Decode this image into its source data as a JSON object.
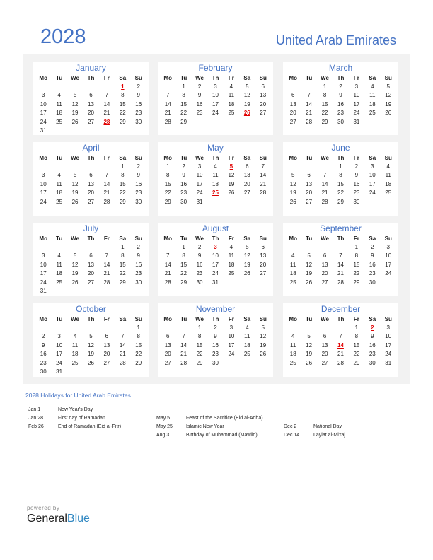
{
  "header": {
    "year": "2028",
    "country": "United Arab Emirates"
  },
  "dow": [
    "Mo",
    "Tu",
    "We",
    "Th",
    "Fr",
    "Sa",
    "Su"
  ],
  "colors": {
    "accent": "#4472c4",
    "holiday": "#e00000",
    "background_panel": "#f2f2f2"
  },
  "months": [
    {
      "name": "January",
      "weeks": [
        [
          "",
          "",
          "",
          "",
          "",
          "1",
          "2"
        ],
        [
          "3",
          "4",
          "5",
          "6",
          "7",
          "8",
          "9"
        ],
        [
          "10",
          "11",
          "12",
          "13",
          "14",
          "15",
          "16"
        ],
        [
          "17",
          "18",
          "19",
          "20",
          "21",
          "22",
          "23"
        ],
        [
          "24",
          "25",
          "26",
          "27",
          "28",
          "29",
          "30"
        ],
        [
          "31",
          "",
          "",
          "",
          "",
          "",
          ""
        ]
      ],
      "holidays": [
        "1",
        "28"
      ]
    },
    {
      "name": "February",
      "weeks": [
        [
          "",
          "1",
          "2",
          "3",
          "4",
          "5",
          "6"
        ],
        [
          "7",
          "8",
          "9",
          "10",
          "11",
          "12",
          "13"
        ],
        [
          "14",
          "15",
          "16",
          "17",
          "18",
          "19",
          "20"
        ],
        [
          "21",
          "22",
          "23",
          "24",
          "25",
          "26",
          "27"
        ],
        [
          "28",
          "29",
          "",
          "",
          "",
          "",
          ""
        ]
      ],
      "holidays": [
        "26"
      ]
    },
    {
      "name": "March",
      "weeks": [
        [
          "",
          "",
          "1",
          "2",
          "3",
          "4",
          "5"
        ],
        [
          "6",
          "7",
          "8",
          "9",
          "10",
          "11",
          "12"
        ],
        [
          "13",
          "14",
          "15",
          "16",
          "17",
          "18",
          "19"
        ],
        [
          "20",
          "21",
          "22",
          "23",
          "24",
          "25",
          "26"
        ],
        [
          "27",
          "28",
          "29",
          "30",
          "31",
          "",
          ""
        ]
      ],
      "holidays": []
    },
    {
      "name": "April",
      "weeks": [
        [
          "",
          "",
          "",
          "",
          "",
          "1",
          "2"
        ],
        [
          "3",
          "4",
          "5",
          "6",
          "7",
          "8",
          "9"
        ],
        [
          "10",
          "11",
          "12",
          "13",
          "14",
          "15",
          "16"
        ],
        [
          "17",
          "18",
          "19",
          "20",
          "21",
          "22",
          "23"
        ],
        [
          "24",
          "25",
          "26",
          "27",
          "28",
          "29",
          "30"
        ]
      ],
      "holidays": []
    },
    {
      "name": "May",
      "weeks": [
        [
          "1",
          "2",
          "3",
          "4",
          "5",
          "6",
          "7"
        ],
        [
          "8",
          "9",
          "10",
          "11",
          "12",
          "13",
          "14"
        ],
        [
          "15",
          "16",
          "17",
          "18",
          "19",
          "20",
          "21"
        ],
        [
          "22",
          "23",
          "24",
          "25",
          "26",
          "27",
          "28"
        ],
        [
          "29",
          "30",
          "31",
          "",
          "",
          "",
          ""
        ]
      ],
      "holidays": [
        "5",
        "25"
      ]
    },
    {
      "name": "June",
      "weeks": [
        [
          "",
          "",
          "",
          "1",
          "2",
          "3",
          "4"
        ],
        [
          "5",
          "6",
          "7",
          "8",
          "9",
          "10",
          "11"
        ],
        [
          "12",
          "13",
          "14",
          "15",
          "16",
          "17",
          "18"
        ],
        [
          "19",
          "20",
          "21",
          "22",
          "23",
          "24",
          "25"
        ],
        [
          "26",
          "27",
          "28",
          "29",
          "30",
          "",
          ""
        ]
      ],
      "holidays": []
    },
    {
      "name": "July",
      "weeks": [
        [
          "",
          "",
          "",
          "",
          "",
          "1",
          "2"
        ],
        [
          "3",
          "4",
          "5",
          "6",
          "7",
          "8",
          "9"
        ],
        [
          "10",
          "11",
          "12",
          "13",
          "14",
          "15",
          "16"
        ],
        [
          "17",
          "18",
          "19",
          "20",
          "21",
          "22",
          "23"
        ],
        [
          "24",
          "25",
          "26",
          "27",
          "28",
          "29",
          "30"
        ],
        [
          "31",
          "",
          "",
          "",
          "",
          "",
          ""
        ]
      ],
      "holidays": []
    },
    {
      "name": "August",
      "weeks": [
        [
          "",
          "1",
          "2",
          "3",
          "4",
          "5",
          "6"
        ],
        [
          "7",
          "8",
          "9",
          "10",
          "11",
          "12",
          "13"
        ],
        [
          "14",
          "15",
          "16",
          "17",
          "18",
          "19",
          "20"
        ],
        [
          "21",
          "22",
          "23",
          "24",
          "25",
          "26",
          "27"
        ],
        [
          "28",
          "29",
          "30",
          "31",
          "",
          "",
          ""
        ]
      ],
      "holidays": [
        "3"
      ]
    },
    {
      "name": "September",
      "weeks": [
        [
          "",
          "",
          "",
          "",
          "1",
          "2",
          "3"
        ],
        [
          "4",
          "5",
          "6",
          "7",
          "8",
          "9",
          "10"
        ],
        [
          "11",
          "12",
          "13",
          "14",
          "15",
          "16",
          "17"
        ],
        [
          "18",
          "19",
          "20",
          "21",
          "22",
          "23",
          "24"
        ],
        [
          "25",
          "26",
          "27",
          "28",
          "29",
          "30",
          ""
        ]
      ],
      "holidays": []
    },
    {
      "name": "October",
      "weeks": [
        [
          "",
          "",
          "",
          "",
          "",
          "",
          "1"
        ],
        [
          "2",
          "3",
          "4",
          "5",
          "6",
          "7",
          "8"
        ],
        [
          "9",
          "10",
          "11",
          "12",
          "13",
          "14",
          "15"
        ],
        [
          "16",
          "17",
          "18",
          "19",
          "20",
          "21",
          "22"
        ],
        [
          "23",
          "24",
          "25",
          "26",
          "27",
          "28",
          "29"
        ],
        [
          "30",
          "31",
          "",
          "",
          "",
          "",
          ""
        ]
      ],
      "holidays": []
    },
    {
      "name": "November",
      "weeks": [
        [
          "",
          "",
          "1",
          "2",
          "3",
          "4",
          "5"
        ],
        [
          "6",
          "7",
          "8",
          "9",
          "10",
          "11",
          "12"
        ],
        [
          "13",
          "14",
          "15",
          "16",
          "17",
          "18",
          "19"
        ],
        [
          "20",
          "21",
          "22",
          "23",
          "24",
          "25",
          "26"
        ],
        [
          "27",
          "28",
          "29",
          "30",
          "",
          "",
          ""
        ]
      ],
      "holidays": []
    },
    {
      "name": "December",
      "weeks": [
        [
          "",
          "",
          "",
          "",
          "1",
          "2",
          "3"
        ],
        [
          "4",
          "5",
          "6",
          "7",
          "8",
          "9",
          "10"
        ],
        [
          "11",
          "12",
          "13",
          "14",
          "15",
          "16",
          "17"
        ],
        [
          "18",
          "19",
          "20",
          "21",
          "22",
          "23",
          "24"
        ],
        [
          "25",
          "26",
          "27",
          "28",
          "29",
          "30",
          "31"
        ]
      ],
      "holidays": [
        "2",
        "14"
      ]
    }
  ],
  "holidays_section": {
    "title": "2028 Holidays for United Arab Emirates",
    "columns": [
      [
        {
          "date": "Jan 1",
          "name": "New Year's Day"
        },
        {
          "date": "Jan 28",
          "name": "First day of Ramadan"
        },
        {
          "date": "Feb 26",
          "name": "End of Ramadan (Eid al-Fitr)"
        }
      ],
      [
        {
          "date": "May 5",
          "name": "Feast of the Sacrifice (Eid al-Adha)"
        },
        {
          "date": "May 25",
          "name": "Islamic New Year"
        },
        {
          "date": "Aug 3",
          "name": "Birthday of Muhammad (Mawlid)"
        }
      ],
      [
        {
          "date": "Dec 2",
          "name": "National Day"
        },
        {
          "date": "Dec 14",
          "name": "Laylat al-Mi'raj"
        }
      ]
    ]
  },
  "footer": {
    "powered_by": "powered by",
    "brand_general": "General",
    "brand_blue": "Blue"
  }
}
